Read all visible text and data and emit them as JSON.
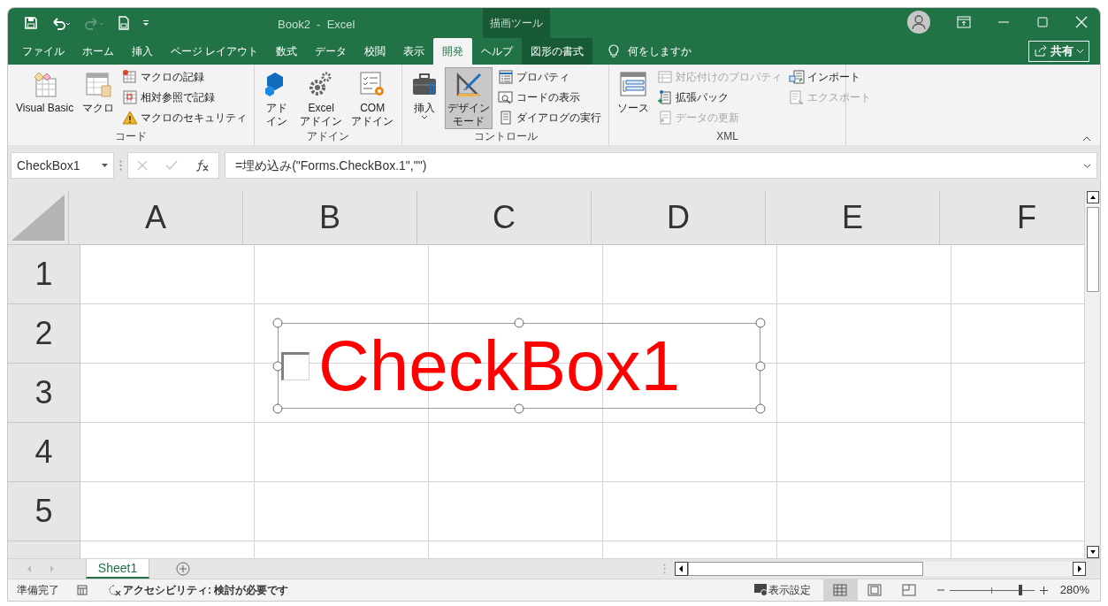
{
  "window": {
    "title": "Book2  -  Excel",
    "context_label": "描画ツール"
  },
  "tabs": [
    {
      "label": "ファイル",
      "selected": false,
      "kind": "normal"
    },
    {
      "label": "ホーム",
      "selected": false,
      "kind": "normal"
    },
    {
      "label": "挿入",
      "selected": false,
      "kind": "normal"
    },
    {
      "label": "ページ レイアウト",
      "selected": false,
      "kind": "normal"
    },
    {
      "label": "数式",
      "selected": false,
      "kind": "normal"
    },
    {
      "label": "データ",
      "selected": false,
      "kind": "normal"
    },
    {
      "label": "校閲",
      "selected": false,
      "kind": "normal"
    },
    {
      "label": "表示",
      "selected": false,
      "kind": "normal"
    },
    {
      "label": "開発",
      "selected": true,
      "kind": "normal"
    },
    {
      "label": "ヘルプ",
      "selected": false,
      "kind": "normal"
    },
    {
      "label": "図形の書式",
      "selected": false,
      "kind": "contextual"
    }
  ],
  "tell_me": "何をしますか",
  "share_button": "共有",
  "ribbon_groups": [
    {
      "label": "コード",
      "items": [
        {
          "lines": [
            "Visual Basic"
          ],
          "kind": "large",
          "pressed": false,
          "disabled": false
        },
        {
          "lines": [
            "マクロ"
          ],
          "kind": "large",
          "pressed": false,
          "disabled": false
        },
        {
          "label": "マクロの記録",
          "kind": "small",
          "pressed": false,
          "disabled": false
        },
        {
          "label": "相対参照で記録",
          "kind": "small",
          "pressed": false,
          "disabled": false
        },
        {
          "label": "マクロのセキュリティ",
          "kind": "small",
          "pressed": false,
          "disabled": false
        }
      ]
    },
    {
      "label": "アドイン",
      "items": [
        {
          "lines": [
            "アド",
            "イン"
          ],
          "kind": "large",
          "pressed": false,
          "disabled": false
        },
        {
          "lines": [
            "Excel",
            "アドイン"
          ],
          "kind": "large",
          "pressed": false,
          "disabled": false
        },
        {
          "lines": [
            "COM",
            "アドイン"
          ],
          "kind": "large",
          "pressed": false,
          "disabled": false
        }
      ]
    },
    {
      "label": "コントロール",
      "items": [
        {
          "lines": [
            "挿入"
          ],
          "kind": "large",
          "pressed": false,
          "disabled": false
        },
        {
          "lines": [
            "デザイン",
            "モード"
          ],
          "kind": "large",
          "pressed": true,
          "disabled": false
        },
        {
          "label": "プロパティ",
          "kind": "small",
          "pressed": false,
          "disabled": false
        },
        {
          "label": "コードの表示",
          "kind": "small",
          "pressed": false,
          "disabled": false
        },
        {
          "label": "ダイアログの実行",
          "kind": "small",
          "pressed": false,
          "disabled": false
        }
      ]
    },
    {
      "label": "XML",
      "items": [
        {
          "lines": [
            "ソース"
          ],
          "kind": "large",
          "pressed": false,
          "disabled": false
        },
        {
          "label": "対応付けのプロパティ",
          "kind": "small",
          "pressed": false,
          "disabled": true
        },
        {
          "label": "拡張パック",
          "kind": "small",
          "pressed": false,
          "disabled": false
        },
        {
          "label": "データの更新",
          "kind": "small",
          "pressed": false,
          "disabled": true
        },
        {
          "label": "インポート",
          "kind": "small",
          "pressed": false,
          "disabled": false
        },
        {
          "label": "エクスポート",
          "kind": "small",
          "pressed": false,
          "disabled": true
        }
      ]
    }
  ],
  "name_box": "CheckBox1",
  "formula": "=埋め込み(\"Forms.CheckBox.1\",\"\")",
  "columns": [
    "A",
    "B",
    "C",
    "D",
    "E",
    "F"
  ],
  "rows": [
    "1",
    "2",
    "3",
    "4",
    "5"
  ],
  "embedded_checkbox": {
    "label": "CheckBox1",
    "checked": false,
    "selected": true
  },
  "sheet_tabs": [
    {
      "label": "Sheet1",
      "selected": true
    }
  ],
  "status_bar": {
    "ready": "準備完了",
    "accessibility": "アクセシビリティ: 検討が必要です",
    "display_settings": "表示設定",
    "views": [
      {
        "selected": true
      },
      {
        "selected": false
      },
      {
        "selected": false
      }
    ],
    "zoom": {
      "level": 0.85,
      "reading": "280%"
    }
  }
}
